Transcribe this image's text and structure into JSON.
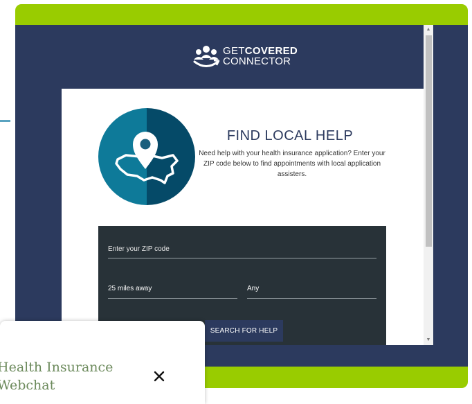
{
  "logo": {
    "line1_a": "GET",
    "line1_b": "COVERED",
    "line2": "CONNECTOR"
  },
  "help": {
    "title": "FIND LOCAL HELP",
    "description": "Need help with your health insurance application? Enter your ZIP code below to find appointments with local application assisters."
  },
  "form": {
    "zip_placeholder": "Enter your ZIP code",
    "zip_value": "",
    "distance_selected": "25 miles away",
    "type_selected": "Any",
    "search_label": "SEARCH FOR HELP"
  },
  "scrollbar": {
    "up_arrow": "▲",
    "down_arrow": "▼"
  },
  "webchat": {
    "title_line1": "Health Insurance",
    "title_line2": "Webchat"
  },
  "colors": {
    "frame_green": "#99cc00",
    "navy": "#2c3a5e",
    "panel_dark": "#283238",
    "teal": "#0e7a99",
    "teal_dark": "#054a68"
  }
}
